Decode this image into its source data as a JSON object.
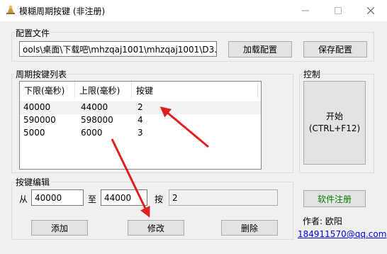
{
  "window": {
    "title": "模糊周期按键 (非注册)"
  },
  "config": {
    "group_label": "配置文件",
    "path": "ools\\桌面\\下载吧\\mhzqaj1001\\mhzqaj1001\\D3.ini",
    "load_label": "加载配置",
    "save_label": "保存配置"
  },
  "list": {
    "group_label": "周期按键列表",
    "columns": [
      "下限(毫秒)",
      "上限(毫秒)",
      "按键"
    ],
    "rows": [
      {
        "low": "40000",
        "high": "44000",
        "key": "2"
      },
      {
        "low": "590000",
        "high": "598000",
        "key": "4"
      },
      {
        "low": "5000",
        "high": "6000",
        "key": "3"
      }
    ]
  },
  "control": {
    "group_label": "控制",
    "start_line1": "开始",
    "start_line2": "(CTRL+F12)",
    "register_label": "软件注册",
    "author": "作者: 欧阳",
    "contact": "184911570@qq.com"
  },
  "editor": {
    "group_label": "按键编辑",
    "from_label": "从",
    "from_value": "40000",
    "to_label": "至",
    "to_value": "44000",
    "key_label": "按",
    "key_value": "2",
    "add_label": "添加",
    "modify_label": "修改",
    "delete_label": "删除"
  },
  "colors": {
    "register_text": "#008000",
    "annotation_arrow": "#e02020",
    "link": "#0000ee"
  }
}
